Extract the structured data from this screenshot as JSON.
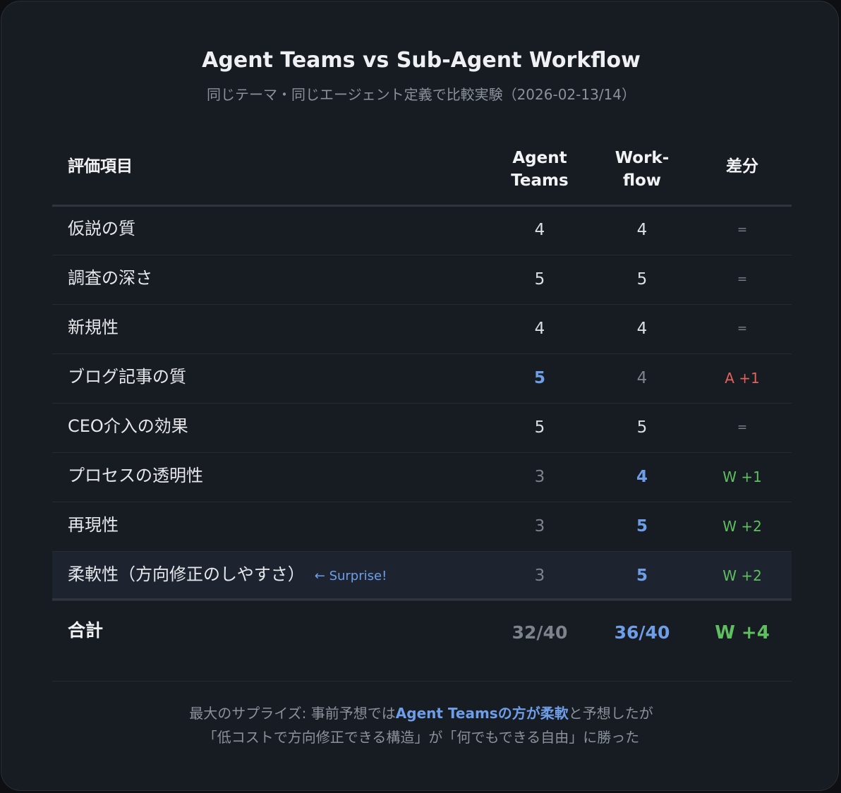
{
  "title": "Agent Teams vs Sub-Agent Workflow",
  "subtitle": "同じテーマ・同じエージェント定義で比較実験（2026-02-13/14）",
  "colors": {
    "background": "#171b22",
    "accent": "#6f9ee8",
    "agent_delta": "#e0625a",
    "workflow_delta": "#5fbe5f"
  },
  "chart_data": {
    "type": "table",
    "columns": {
      "item": "評価項目",
      "agent_line1": "Agent",
      "agent_line2": "Teams",
      "workflow_line1": "Work-",
      "workflow_line2": "flow",
      "diff": "差分"
    },
    "rows": [
      {
        "label": "仮説の質",
        "note": "",
        "agent": "4",
        "workflow": "4",
        "diff": "=",
        "winner": "none",
        "highlight": false
      },
      {
        "label": "調査の深さ",
        "note": "",
        "agent": "5",
        "workflow": "5",
        "diff": "=",
        "winner": "none",
        "highlight": false
      },
      {
        "label": "新規性",
        "note": "",
        "agent": "4",
        "workflow": "4",
        "diff": "=",
        "winner": "none",
        "highlight": false
      },
      {
        "label": "ブログ記事の質",
        "note": "",
        "agent": "5",
        "workflow": "4",
        "diff": "A +1",
        "winner": "agent",
        "highlight": false
      },
      {
        "label": "CEO介入の効果",
        "note": "",
        "agent": "5",
        "workflow": "5",
        "diff": "=",
        "winner": "none",
        "highlight": false
      },
      {
        "label": "プロセスの透明性",
        "note": "",
        "agent": "3",
        "workflow": "4",
        "diff": "W +1",
        "winner": "workflow",
        "highlight": false
      },
      {
        "label": "再現性",
        "note": "",
        "agent": "3",
        "workflow": "5",
        "diff": "W +2",
        "winner": "workflow",
        "highlight": false
      },
      {
        "label": "柔軟性（方向修正のしやすさ）",
        "note": "← Surprise!",
        "agent": "3",
        "workflow": "5",
        "diff": "W +2",
        "winner": "workflow",
        "highlight": true
      }
    ],
    "total": {
      "label": "合計",
      "agent": "32/40",
      "workflow": "36/40",
      "diff": "W +4"
    }
  },
  "footer": {
    "line1_before": "最大のサプライズ: 事前予想では",
    "line1_emphasis": "Agent Teamsの方が柔軟",
    "line1_after": "と予想したが",
    "line2": "「低コストで方向修正できる構造」が「何でもできる自由」に勝った"
  }
}
